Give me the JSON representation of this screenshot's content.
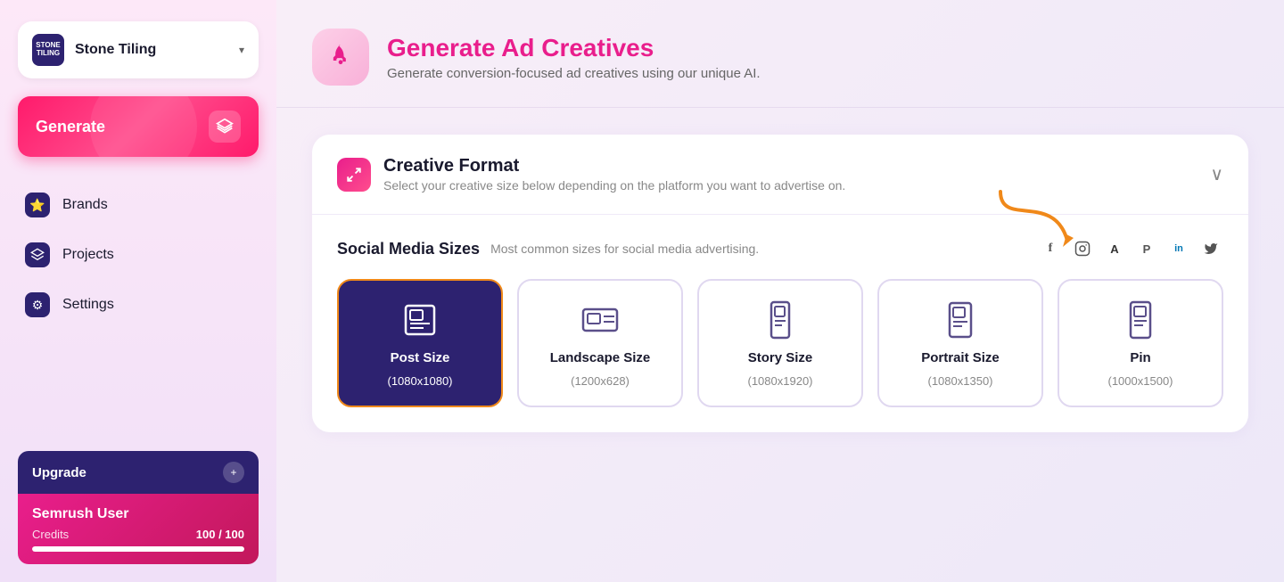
{
  "sidebar": {
    "brand": {
      "name": "Stone Tiling",
      "logo_text": "STONE\nTILING"
    },
    "generate_btn_label": "Generate",
    "nav_items": [
      {
        "id": "brands",
        "label": "Brands",
        "icon": "⭐"
      },
      {
        "id": "projects",
        "label": "Projects",
        "icon": "🗂"
      },
      {
        "id": "settings",
        "label": "Settings",
        "icon": "⚙️"
      }
    ],
    "upgrade": {
      "btn_label": "Upgrade",
      "user_name": "Semrush User",
      "credits_label": "Credits",
      "credits_current": "100",
      "credits_max": "100",
      "credits_pct": 100
    }
  },
  "header": {
    "title": "Generate Ad Creatives",
    "subtitle": "Generate conversion-focused ad creatives using our unique AI."
  },
  "creative_format": {
    "title": "Creative Format",
    "subtitle": "Select your creative size below depending on the platform you want to advertise on.",
    "social_media": {
      "section_title": "Social Media Sizes",
      "section_desc": "Most common sizes for social media advertising.",
      "sizes": [
        {
          "id": "post",
          "name": "Post Size",
          "dims": "(1080x1080)",
          "selected": true,
          "aspect": "square"
        },
        {
          "id": "landscape",
          "name": "Landscape Size",
          "dims": "(1200x628)",
          "selected": false,
          "aspect": "landscape"
        },
        {
          "id": "story",
          "name": "Story Size",
          "dims": "(1080x1920)",
          "selected": false,
          "aspect": "portrait-tall"
        },
        {
          "id": "portrait",
          "name": "Portrait Size",
          "dims": "(1080x1350)",
          "selected": false,
          "aspect": "portrait"
        },
        {
          "id": "pin",
          "name": "Pin",
          "dims": "(1000x1500)",
          "selected": false,
          "aspect": "portrait-tall"
        }
      ]
    }
  },
  "icons": {
    "rocket": "🚀",
    "layers": "🗂",
    "expand": "↗",
    "chevron_down": "∨",
    "facebook": "f",
    "instagram": "⬡",
    "adroll": "A",
    "pinterest": "P",
    "linkedin": "in",
    "twitter": "🐦",
    "plus": "+"
  }
}
